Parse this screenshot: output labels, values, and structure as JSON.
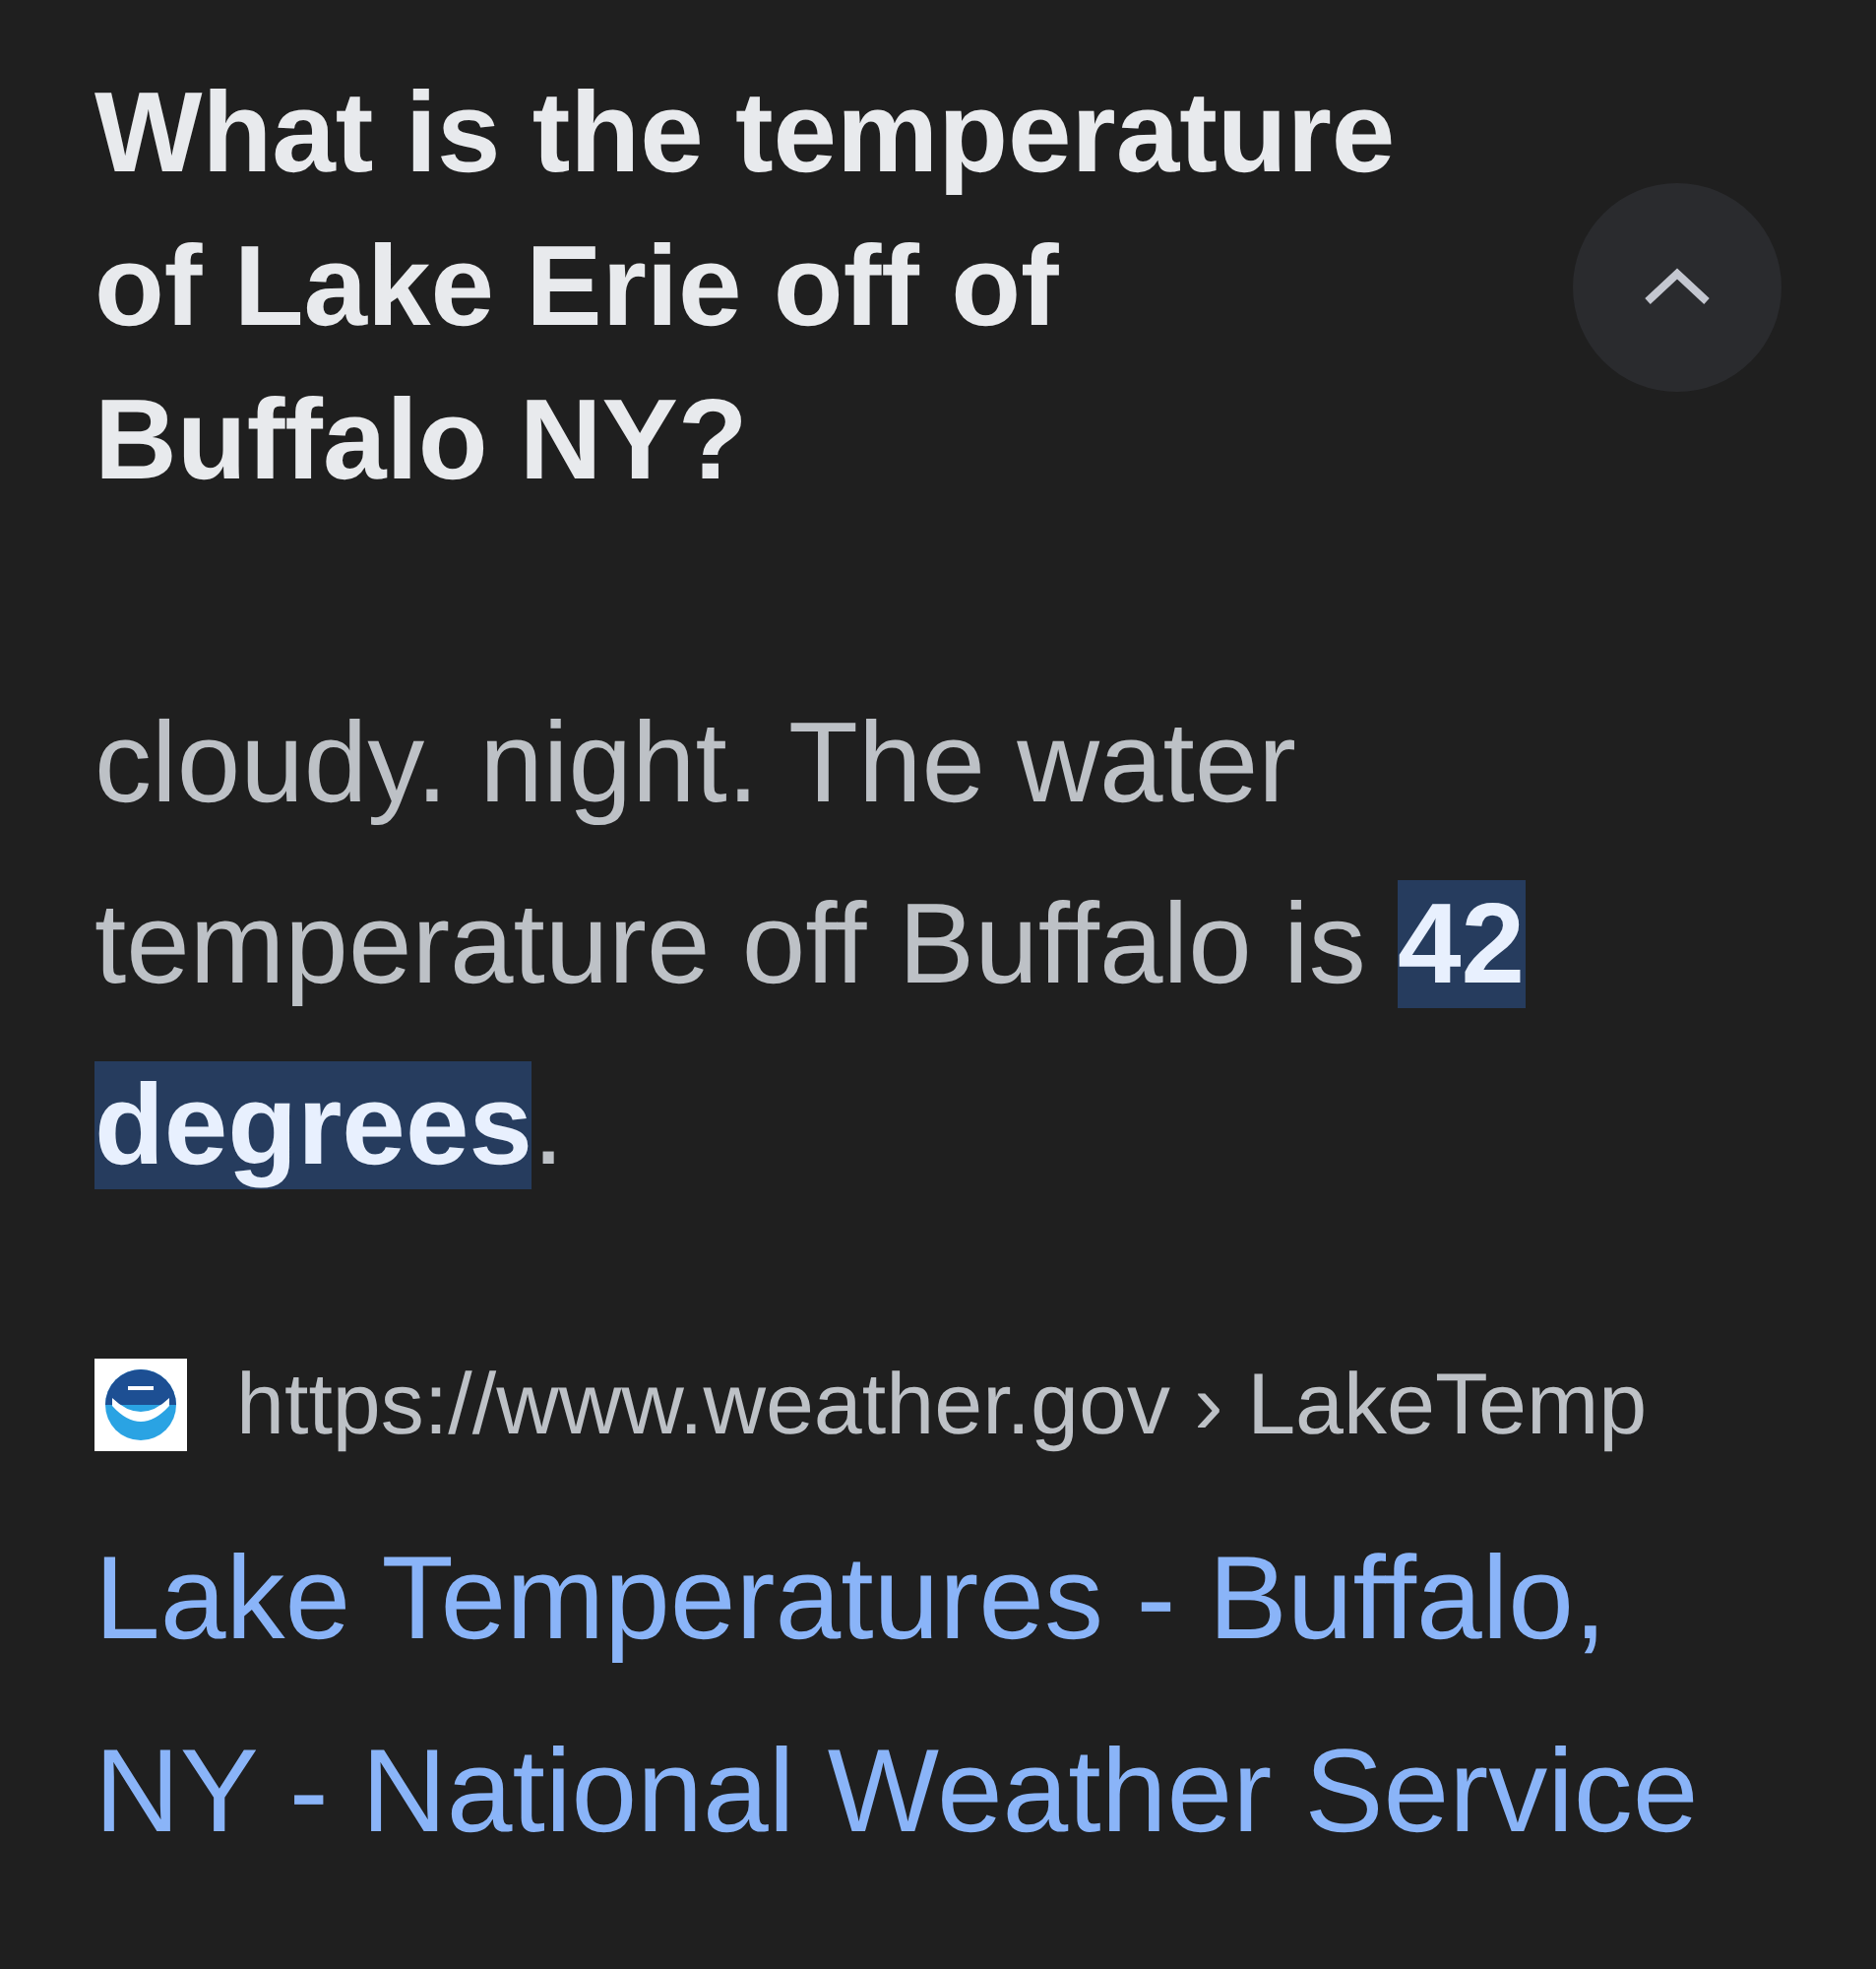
{
  "question": {
    "title": "What is the temperature of Lake Erie off of Buffalo NY?",
    "expanded": true
  },
  "answer": {
    "text": "cloudy. night. The water temperature off Buffalo is **42 degrees**."
  },
  "source": {
    "url": "https://www.weather.gov › LakeTemp",
    "title": "Lake Temperatures - Buffalo, NY - National Weather Service"
  }
}
